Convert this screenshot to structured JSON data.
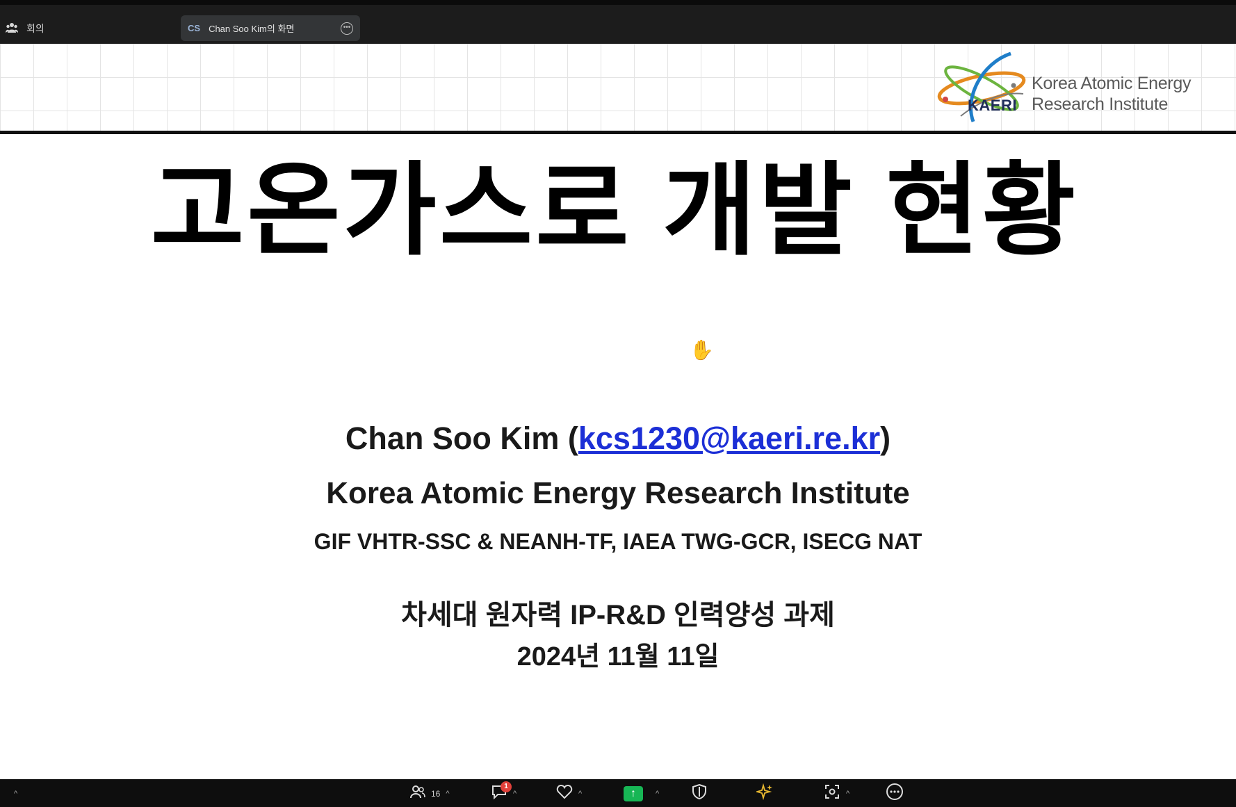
{
  "topbar": {
    "meeting_icon": "people-icon",
    "meeting_label": "회의",
    "share_avatar": "CS",
    "share_title": "Chan Soo Kim의 화면",
    "share_more_icon": "more-icon"
  },
  "slide": {
    "logo": {
      "abbr": "KAERI",
      "name_line1": "Korea Atomic Energy",
      "name_line2": "Research Institute"
    },
    "title": "고온가스로 개발 현황",
    "author_name": "Chan Soo Kim",
    "author_open": " (",
    "author_email": "kcs1230@kaeri.re.kr",
    "author_close": ")",
    "organization": "Korea Atomic Energy Research Institute",
    "roles": "GIF VHTR-SSC & NEANH-TF, IAEA TWG-GCR, ISECG NAT",
    "project": "차세대 원자력 IP-R&D 인력양성 과제",
    "date": "2024년 11월 11일"
  },
  "toolbar": {
    "participants_count": "16",
    "chat_badge": "1",
    "caret": "^"
  },
  "colors": {
    "share_button": "#17b655",
    "badge": "#e0403a",
    "email_link": "#1c2fd6"
  }
}
